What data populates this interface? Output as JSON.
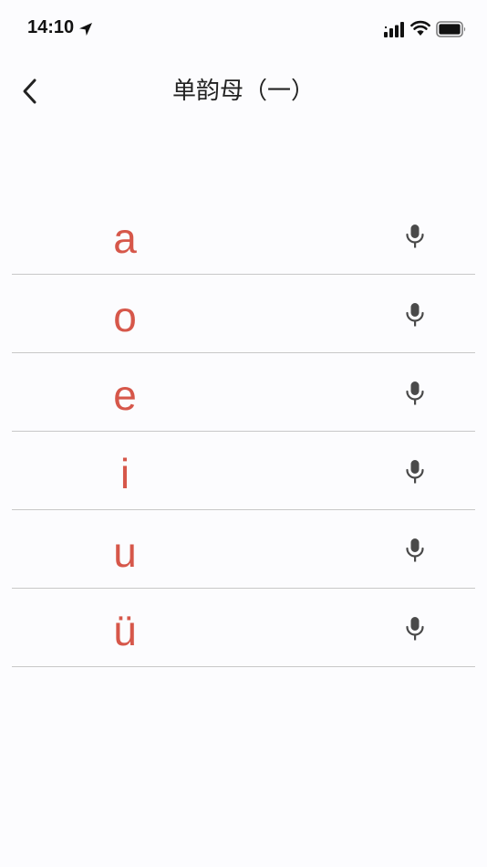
{
  "status_bar": {
    "time": "14:10"
  },
  "nav": {
    "title": "单韵母（一）"
  },
  "rows": [
    {
      "letter": "a"
    },
    {
      "letter": "o"
    },
    {
      "letter": "e"
    },
    {
      "letter": "i"
    },
    {
      "letter": "u"
    },
    {
      "letter": "ü"
    }
  ],
  "colors": {
    "accent": "#d6574a",
    "divider": "#c8c8c8",
    "icon": "#4a4a4a"
  },
  "icons": [
    "back-icon",
    "mic-icon",
    "location-arrow-icon",
    "cellular-signal-icon",
    "wifi-icon",
    "battery-icon"
  ]
}
